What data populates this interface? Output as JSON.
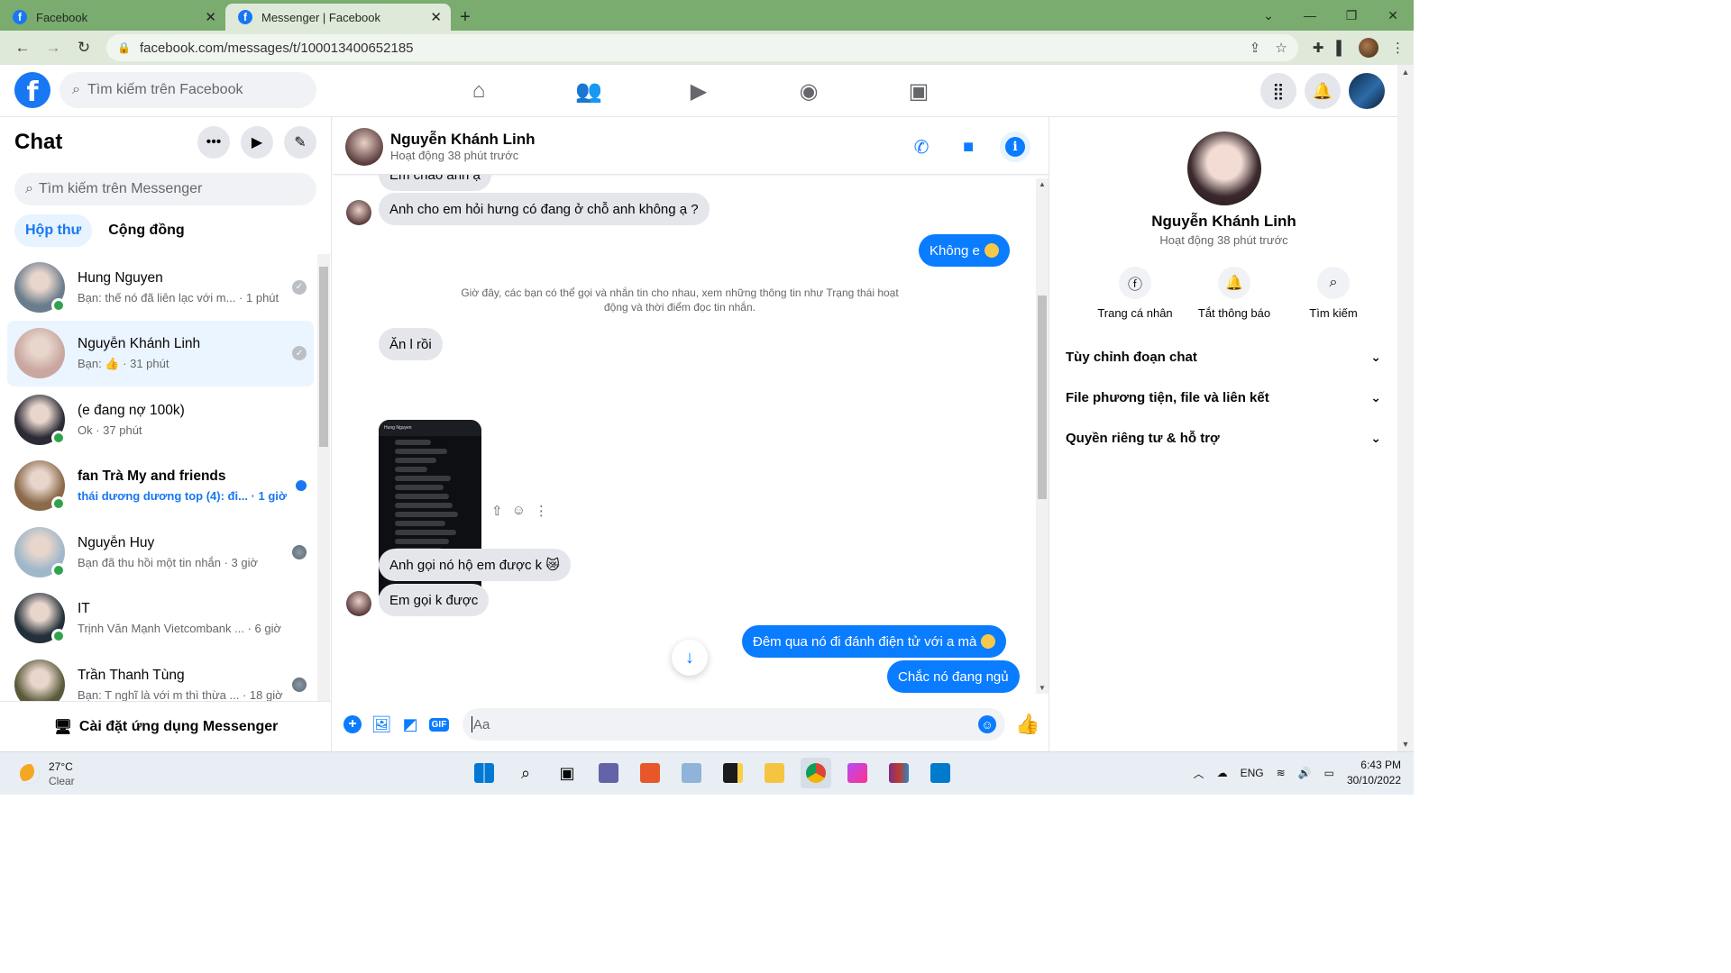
{
  "browser": {
    "tabs": [
      {
        "title": "Facebook",
        "active": false
      },
      {
        "title": "Messenger | Facebook",
        "active": true
      }
    ],
    "url": "facebook.com/messages/t/100013400652185"
  },
  "fb_header": {
    "search_placeholder": "Tìm kiếm trên Facebook",
    "nav_icons": [
      "home-icon",
      "friends-icon",
      "watch-icon",
      "groups-icon",
      "gaming-icon"
    ]
  },
  "chat_list": {
    "title": "Chat",
    "search_placeholder": "Tìm kiếm trên Messenger",
    "tabs": [
      "Hộp thư",
      "Cộng đồng"
    ],
    "conversations": [
      {
        "name": "Hung Nguyen",
        "preview": "Bạn: thế nó đã liên lạc với m... · 1 phút",
        "online": true,
        "status": "seen",
        "color": "#6b7d8c"
      },
      {
        "name": "Nguyễn Khánh Linh",
        "preview": "Bạn: 👍 · 31 phút",
        "online": false,
        "status": "seen",
        "color": "#c9a7a0"
      },
      {
        "name": "(e đang nợ 100k)",
        "preview": "Ok · 37 phút",
        "online": true,
        "status": "",
        "color": "#2b2a35"
      },
      {
        "name": "fan Trà My and friends",
        "preview": "thái dương dương top (4): đi... · 1 giờ",
        "online": true,
        "status": "unread",
        "color": "#8a6a4a"
      },
      {
        "name": "Nguyễn Huy",
        "preview": "Bạn đã thu hồi một tin nhắn · 3 giờ",
        "online": true,
        "status": "mini",
        "color": "#9fb7c9"
      },
      {
        "name": "IT",
        "preview": "Trịnh Văn Mạnh Vietcombank ... · 6 giờ",
        "online": true,
        "status": "",
        "color": "#23303a"
      },
      {
        "name": "Trần Thanh Tùng",
        "preview": "Bạn: T nghĩ là với m thì thừa ... · 18 giờ",
        "online": false,
        "status": "mini",
        "color": "#5a5a3a"
      }
    ],
    "footer": "Cài đặt ứng dụng Messenger"
  },
  "conversation": {
    "contact_name": "Nguyễn Khánh Linh",
    "contact_status": "Hoạt động 38 phút trước",
    "messages": {
      "m0": "Em chào anh ạ",
      "m1": "Anh cho em hỏi hưng có đang ở chỗ anh không ạ ?",
      "m2": "Không e",
      "system": "Giờ đây, các bạn có thể gọi và nhắn tin cho nhau, xem những thông tin như Trạng thái hoạt động và thời điểm đọc tin nhắn.",
      "m3": "Ăn l rồi",
      "m4": "Anh gọi nó hộ em được k 😿",
      "m5": "Em gọi k được",
      "m6": "Đêm qua nó đi đánh điện tử với a mà",
      "m7": "Chắc nó đang ngủ"
    },
    "composer_placeholder": "Aa"
  },
  "info_panel": {
    "name": "Nguyễn Khánh Linh",
    "status": "Hoạt động 38 phút trước",
    "actions": [
      "Trang cá nhân",
      "Tắt thông báo",
      "Tìm kiếm"
    ],
    "sections": [
      "Tùy chỉnh đoạn chat",
      "File phương tiện, file và liên kết",
      "Quyền riêng tư & hỗ trợ"
    ]
  },
  "taskbar": {
    "temperature": "27°C",
    "weather": "Clear",
    "language": "ENG",
    "time": "6:43 PM",
    "date": "30/10/2022"
  }
}
